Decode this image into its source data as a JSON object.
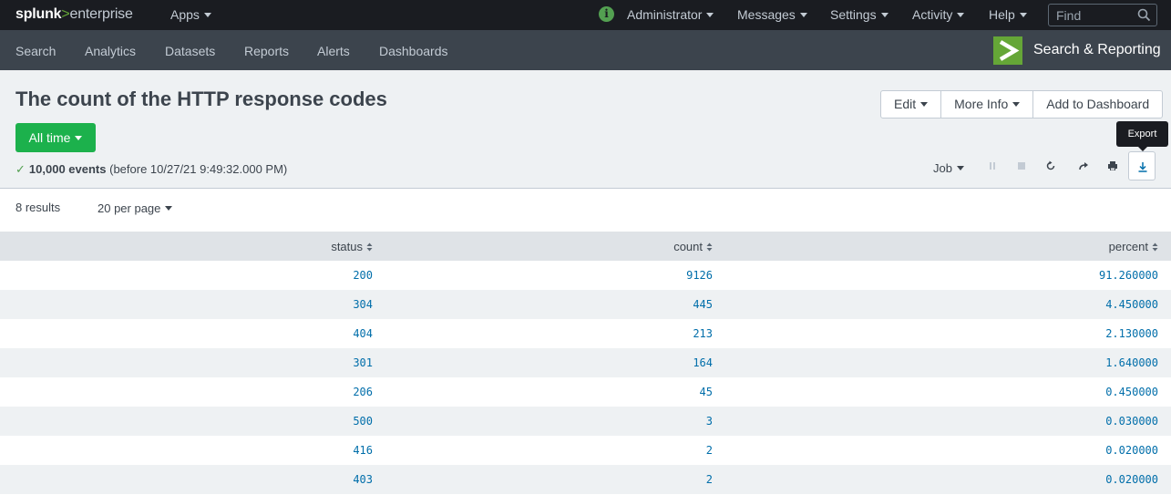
{
  "topbar": {
    "logo_splunk": "splunk",
    "logo_arrow": ">",
    "logo_enterprise": "enterprise",
    "apps": "Apps",
    "administrator": "Administrator",
    "messages": "Messages",
    "settings": "Settings",
    "activity": "Activity",
    "help": "Help",
    "find_placeholder": "Find"
  },
  "appnav": {
    "items": [
      "Search",
      "Analytics",
      "Datasets",
      "Reports",
      "Alerts",
      "Dashboards"
    ],
    "app_title": "Search & Reporting"
  },
  "header": {
    "title": "The count of the HTTP response codes",
    "edit": "Edit",
    "more_info": "More Info",
    "add_to_dashboard": "Add to Dashboard",
    "time_range": "All time",
    "events_count": "10,000 events",
    "events_time": "(before 10/27/21 9:49:32.000 PM)",
    "job": "Job",
    "tooltip": "Export"
  },
  "results": {
    "count": "8 results",
    "per_page": "20 per page",
    "columns": [
      "status",
      "count",
      "percent"
    ],
    "rows": [
      [
        "200",
        "9126",
        "91.260000"
      ],
      [
        "304",
        "445",
        "4.450000"
      ],
      [
        "404",
        "213",
        "2.130000"
      ],
      [
        "301",
        "164",
        "1.640000"
      ],
      [
        "206",
        "45",
        "0.450000"
      ],
      [
        "500",
        "3",
        "0.030000"
      ],
      [
        "416",
        "2",
        "0.020000"
      ],
      [
        "403",
        "2",
        "0.020000"
      ]
    ]
  },
  "colors": {
    "topbar_bg": "#1a1c21",
    "appbar_bg": "#3c444d",
    "accent_green": "#65a637",
    "time_button": "#1cb14c",
    "link_blue": "#006eaa"
  }
}
